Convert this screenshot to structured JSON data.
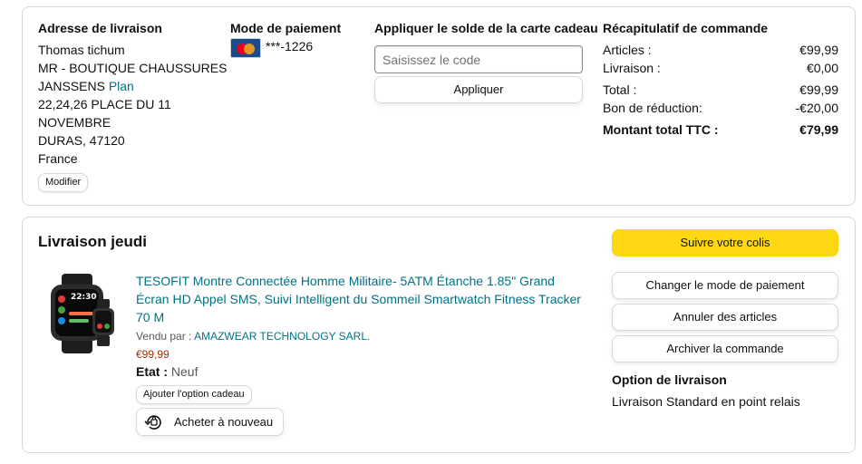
{
  "shipping": {
    "heading": "Adresse de livraison",
    "lines": [
      "Thomas tichum",
      "MR - BOUTIQUE CHAUSSURES",
      "JANSSENS",
      "22,24,26 PLACE DU 11",
      "NOVEMBRE",
      "DURAS, 47120",
      "France"
    ],
    "plan_link": "Plan",
    "modify_button": "Modifier"
  },
  "payment": {
    "heading": "Mode de paiement",
    "card_icon": "mastercard-icon",
    "card_number": "***-1226"
  },
  "gift_card": {
    "heading": "Appliquer le solde de la carte cadeau",
    "placeholder": "Saisissez le code",
    "apply_button": "Appliquer"
  },
  "summary": {
    "heading": "Récapitulatif de commande",
    "rows": [
      {
        "label": "Articles :",
        "value": "€99,99"
      },
      {
        "label": "Livraison :",
        "value": "€0,00"
      },
      {
        "label": "Total :",
        "value": "€99,99"
      },
      {
        "label": "Bon de réduction:",
        "value": "-€20,00"
      }
    ],
    "total_label": "Montant total TTC :",
    "total_value": "€79,99"
  },
  "delivery": {
    "heading": "Livraison jeudi",
    "product": {
      "title_lines": [
        "TESOFIT Montre Connectée Homme Militaire- 5ATM Étanche 1.85\" Grand",
        "Écran HD Appel SMS, Suivi Intelligent du Sommeil Smartwatch Fitness Tracker",
        "70 M"
      ],
      "sold_by_label": "Vendu par :",
      "seller": "AMAZWEAR TECHNOLOGY SARL.",
      "price": "€99,99",
      "condition_label": "Etat :",
      "condition_value": "Neuf",
      "gift_button": "Ajouter l'option cadeau",
      "rebuy_button": "Acheter à nouveau",
      "watch_time": "22:30"
    },
    "actions": {
      "track": "Suivre votre colis",
      "change_payment": "Changer le mode de paiement",
      "cancel": "Annuler des articles",
      "archive": "Archiver la commande"
    },
    "option_heading": "Option de livraison",
    "option_value": "Livraison Standard en point relais"
  },
  "colors": {
    "link": "#007185",
    "price": "#b12704",
    "primary_button": "#ffd814",
    "border": "#d5d9d9"
  }
}
